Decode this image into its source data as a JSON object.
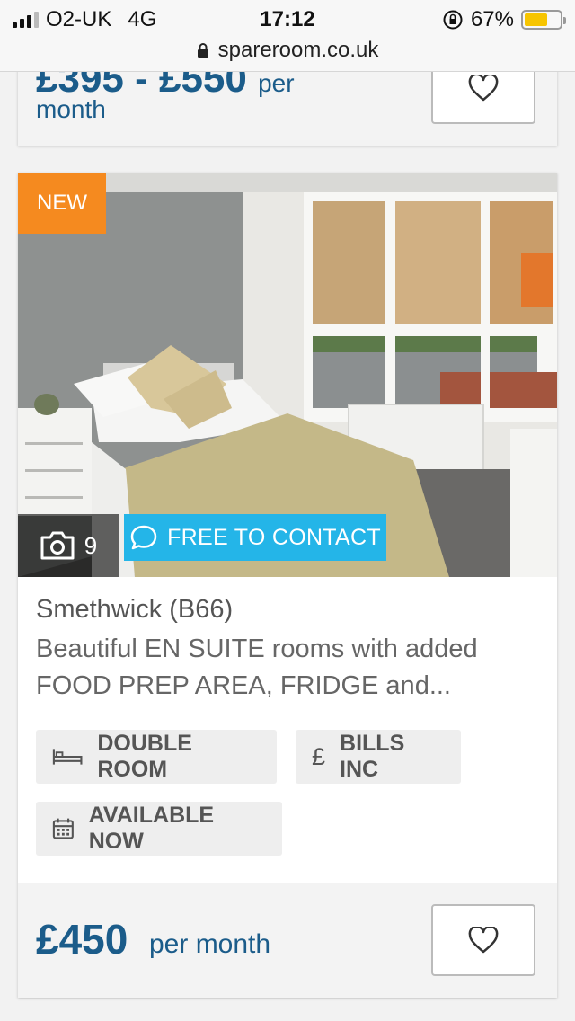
{
  "status_bar": {
    "carrier": "O2-UK",
    "network": "4G",
    "time": "17:12",
    "battery": "67%",
    "battery_level": 0.67,
    "url": "spareroom.co.uk"
  },
  "previous_listing": {
    "price": "£395 - £550",
    "per": "per",
    "month": "month"
  },
  "listing": {
    "badge": "NEW",
    "photo_count": "9",
    "contact_label": "FREE TO CONTACT",
    "location": "Smethwick (B66)",
    "description": "Beautiful EN SUITE rooms with added FOOD PREP AREA, FRIDGE and...",
    "features": {
      "room_type": "DOUBLE ROOM",
      "bills": "BILLS INC",
      "bills_icon": "£",
      "availability": "AVAILABLE NOW"
    },
    "price": "£450",
    "price_period": "per month"
  },
  "colors": {
    "accent_blue": "#1b5c8a",
    "new_badge": "#f58a1f",
    "contact_button": "#24b5e8"
  }
}
